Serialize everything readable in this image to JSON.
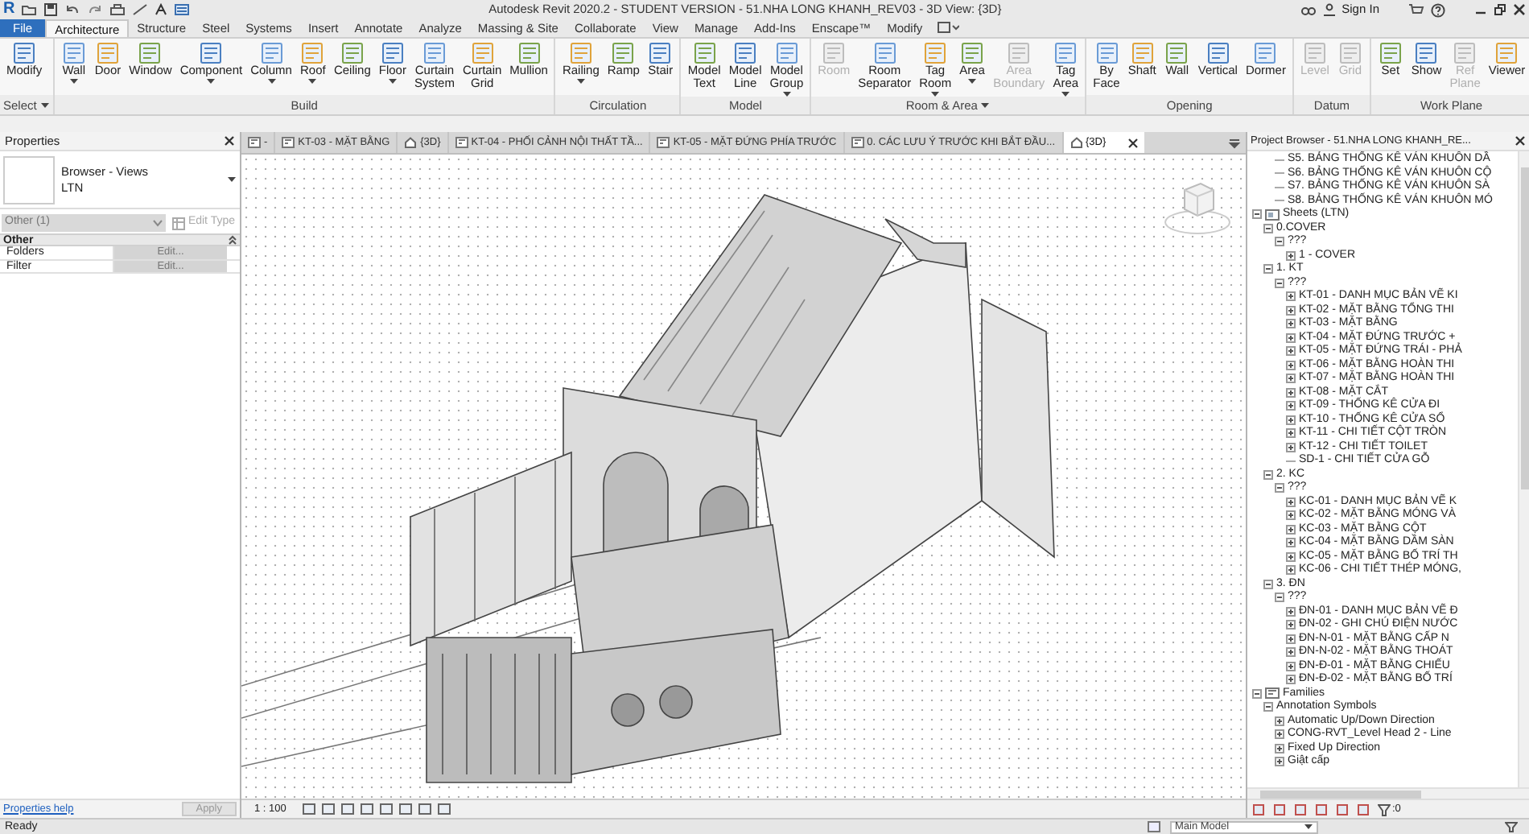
{
  "title_bar": {
    "logo": "R",
    "title": "Autodesk Revit 2020.2 - STUDENT VERSION - 51.NHA LONG KHANH_REV03 - 3D View: {3D}",
    "sign_in": "Sign In"
  },
  "ribbon_tabs": [
    {
      "label": "File",
      "kind": "file",
      "selected": false
    },
    {
      "label": "Architecture",
      "kind": "tab",
      "selected": true
    },
    {
      "label": "Structure",
      "kind": "tab",
      "selected": false
    },
    {
      "label": "Steel",
      "kind": "tab",
      "selected": false
    },
    {
      "label": "Systems",
      "kind": "tab",
      "selected": false
    },
    {
      "label": "Insert",
      "kind": "tab",
      "selected": false
    },
    {
      "label": "Annotate",
      "kind": "tab",
      "selected": false
    },
    {
      "label": "Analyze",
      "kind": "tab",
      "selected": false
    },
    {
      "label": "Massing & Site",
      "kind": "tab",
      "selected": false
    },
    {
      "label": "Collaborate",
      "kind": "tab",
      "selected": false
    },
    {
      "label": "View",
      "kind": "tab",
      "selected": false
    },
    {
      "label": "Manage",
      "kind": "tab",
      "selected": false
    },
    {
      "label": "Add-Ins",
      "kind": "tab",
      "selected": false
    },
    {
      "label": "Enscape™",
      "kind": "tab",
      "selected": false
    },
    {
      "label": "Modify",
      "kind": "tab",
      "selected": false
    }
  ],
  "ribbon_panels": [
    {
      "title": "Select",
      "menu": true,
      "tools": [
        {
          "label": "Modify",
          "disabled": false,
          "dropdown": false
        }
      ]
    },
    {
      "title": "Build",
      "menu": false,
      "tools": [
        {
          "label": "Wall",
          "disabled": false,
          "dropdown": true
        },
        {
          "label": "Door",
          "disabled": false,
          "dropdown": false
        },
        {
          "label": "Window",
          "disabled": false,
          "dropdown": false
        },
        {
          "label": "Component",
          "disabled": false,
          "dropdown": true
        },
        {
          "label": "Column",
          "disabled": false,
          "dropdown": true
        },
        {
          "label": "Roof",
          "disabled": false,
          "dropdown": true
        },
        {
          "label": "Ceiling",
          "disabled": false,
          "dropdown": false
        },
        {
          "label": "Floor",
          "disabled": false,
          "dropdown": true
        },
        {
          "label": "Curtain System",
          "disabled": false,
          "dropdown": false
        },
        {
          "label": "Curtain Grid",
          "disabled": false,
          "dropdown": false
        },
        {
          "label": "Mullion",
          "disabled": false,
          "dropdown": false
        }
      ]
    },
    {
      "title": "Circulation",
      "menu": false,
      "tools": [
        {
          "label": "Railing",
          "disabled": false,
          "dropdown": true
        },
        {
          "label": "Ramp",
          "disabled": false,
          "dropdown": false
        },
        {
          "label": "Stair",
          "disabled": false,
          "dropdown": false
        }
      ]
    },
    {
      "title": "Model",
      "menu": false,
      "tools": [
        {
          "label": "Model Text",
          "disabled": false,
          "dropdown": false
        },
        {
          "label": "Model Line",
          "disabled": false,
          "dropdown": false
        },
        {
          "label": "Model Group",
          "disabled": false,
          "dropdown": true
        }
      ]
    },
    {
      "title": "Room & Area",
      "menu": true,
      "tools": [
        {
          "label": "Room",
          "disabled": true,
          "dropdown": false
        },
        {
          "label": "Room Separator",
          "disabled": false,
          "dropdown": false
        },
        {
          "label": "Tag Room",
          "disabled": false,
          "dropdown": true
        },
        {
          "label": "Area",
          "disabled": false,
          "dropdown": true
        },
        {
          "label": "Area Boundary",
          "disabled": true,
          "dropdown": false
        },
        {
          "label": "Tag Area",
          "disabled": false,
          "dropdown": true
        }
      ]
    },
    {
      "title": "Opening",
      "menu": false,
      "tools": [
        {
          "label": "By Face",
          "disabled": false,
          "dropdown": false
        },
        {
          "label": "Shaft",
          "disabled": false,
          "dropdown": false
        },
        {
          "label": "Wall",
          "disabled": false,
          "dropdown": false
        },
        {
          "label": "Vertical",
          "disabled": false,
          "dropdown": false
        },
        {
          "label": "Dormer",
          "disabled": false,
          "dropdown": false
        }
      ]
    },
    {
      "title": "Datum",
      "menu": false,
      "tools": [
        {
          "label": "Level",
          "disabled": true,
          "dropdown": false
        },
        {
          "label": "Grid",
          "disabled": true,
          "dropdown": false
        }
      ]
    },
    {
      "title": "Work Plane",
      "menu": false,
      "tools": [
        {
          "label": "Set",
          "disabled": false,
          "dropdown": false
        },
        {
          "label": "Show",
          "disabled": false,
          "dropdown": false
        },
        {
          "label": "Ref Plane",
          "disabled": true,
          "dropdown": false
        },
        {
          "label": "Viewer",
          "disabled": false,
          "dropdown": false
        }
      ]
    }
  ],
  "properties": {
    "title": "Properties",
    "type_name": "Browser - Views",
    "type_value": "LTN",
    "selector": "Other (1)",
    "edit_type": {
      "label": "Edit Type",
      "disabled": true
    },
    "section": "Other",
    "rows": [
      {
        "name": "Folders",
        "value": "Edit..."
      },
      {
        "name": "Filter",
        "value": "Edit..."
      }
    ],
    "help_link": "Properties help",
    "apply": "Apply"
  },
  "view_tabs": [
    {
      "label": "-",
      "kind": "plan",
      "selected": false
    },
    {
      "label": "KT-03 - MẶT BẰNG",
      "kind": "plan",
      "selected": false
    },
    {
      "label": "{3D}",
      "kind": "model3d",
      "selected": false
    },
    {
      "label": "KT-04 - PHỐI CẢNH NỘI THẤT TẦ...",
      "kind": "plan",
      "selected": false
    },
    {
      "label": "KT-05 - MẶT ĐỨNG PHÍA TRƯỚC",
      "kind": "plan",
      "selected": false
    },
    {
      "label": "0. CÁC LƯU Ý TRƯỚC KHI BẮT ĐẦU...",
      "kind": "plan",
      "selected": false
    },
    {
      "label": "{3D}",
      "kind": "model3d",
      "selected": true
    }
  ],
  "view_control_bar": {
    "scale": "1 : 100"
  },
  "project_browser": {
    "title": "Project Browser - 51.NHA LONG KHANH_RE...",
    "continued_items": [
      {
        "label": "S5. BẢNG THỐNG KÊ VÁN KHUÔN DẦ"
      },
      {
        "label": "S6. BẢNG THỐNG KÊ VÁN KHUÔN CỘ"
      },
      {
        "label": "S7. BẢNG THỐNG KÊ VÁN KHUÔN SÀ"
      },
      {
        "label": "S8. BẢNG THỐNG KÊ VÁN KHUÔN MÓ"
      }
    ],
    "tree": [
      {
        "label": "Sheets (LTN)",
        "kind": "sheets",
        "expanded": true,
        "children": [
          {
            "label": "0.COVER",
            "expanded": true,
            "children": [
              {
                "label": "???",
                "expanded": true,
                "children": [
                  {
                    "label": "1 - COVER",
                    "expanded": false
                  }
                ]
              }
            ]
          },
          {
            "label": "1. KT",
            "expanded": true,
            "children": [
              {
                "label": "???",
                "expanded": true,
                "children": [
                  {
                    "label": "KT-01 - DANH MỤC BẢN VẼ KI",
                    "expanded": false
                  },
                  {
                    "label": "KT-02 - MẶT BẰNG TỔNG THI",
                    "expanded": false
                  },
                  {
                    "label": "KT-03 - MẶT BẰNG",
                    "expanded": false
                  },
                  {
                    "label": "KT-04 - MẶT ĐỨNG TRƯỚC +",
                    "expanded": false
                  },
                  {
                    "label": "KT-05 - MẶT ĐỨNG TRÁI - PHẢ",
                    "expanded": false
                  },
                  {
                    "label": "KT-06 - MẶT BẰNG HOÀN THI",
                    "expanded": false
                  },
                  {
                    "label": "KT-07 - MẶT BẰNG HOÀN THI",
                    "expanded": false
                  },
                  {
                    "label": "KT-08 - MẶT CẮT",
                    "expanded": false
                  },
                  {
                    "label": "KT-09 - THỐNG KÊ CỬA ĐI",
                    "expanded": false
                  },
                  {
                    "label": "KT-10 - THỐNG KÊ CỬA SỔ",
                    "expanded": false
                  },
                  {
                    "label": "KT-11 - CHI TIẾT CỘT TRÒN",
                    "expanded": false
                  },
                  {
                    "label": "KT-12 - CHI TIẾT TOILET",
                    "expanded": false
                  },
                  {
                    "label": "SD-1 - CHI TIẾT CỬA GỖ"
                  }
                ]
              }
            ]
          },
          {
            "label": "2. KC",
            "expanded": true,
            "children": [
              {
                "label": "???",
                "expanded": true,
                "children": [
                  {
                    "label": "KC-01 - DANH MỤC BẢN VẼ K",
                    "expanded": false
                  },
                  {
                    "label": "KC-02 - MẶT BẰNG MÓNG VÀ",
                    "expanded": false
                  },
                  {
                    "label": "KC-03 - MẶT BẰNG CỘT",
                    "expanded": false
                  },
                  {
                    "label": "KC-04 - MẶT BẰNG DẦM SÀN",
                    "expanded": false
                  },
                  {
                    "label": "KC-05 - MẶT BẰNG BỐ TRÍ TH",
                    "expanded": false
                  },
                  {
                    "label": "KC-06 - CHI TIẾT THÉP MÓNG,",
                    "expanded": false
                  }
                ]
              }
            ]
          },
          {
            "label": "3. ĐN",
            "expanded": true,
            "children": [
              {
                "label": "???",
                "expanded": true,
                "children": [
                  {
                    "label": "ĐN-01 - DANH MỤC BẢN VẼ Đ",
                    "expanded": false
                  },
                  {
                    "label": "ĐN-02 - GHI CHÚ ĐIỆN NƯỚC",
                    "expanded": false
                  },
                  {
                    "label": "ĐN-N-01 - MẶT BẰNG CẤP N",
                    "expanded": false
                  },
                  {
                    "label": "ĐN-N-02 - MẶT BẰNG THOÁT",
                    "expanded": false
                  },
                  {
                    "label": "ĐN-Đ-01 - MẶT BẰNG CHIẾU",
                    "expanded": false
                  },
                  {
                    "label": "ĐN-Đ-02 - MẶT BẰNG BỐ TRÍ",
                    "expanded": false
                  }
                ]
              }
            ]
          }
        ]
      },
      {
        "label": "Families",
        "kind": "families",
        "expanded": true,
        "children": [
          {
            "label": "Annotation Symbols",
            "expanded": true,
            "children": [
              {
                "label": "Automatic Up/Down Direction",
                "expanded": false
              },
              {
                "label": "CONG-RVT_Level Head 2 - Line",
                "expanded": false
              },
              {
                "label": "Fixed Up Direction",
                "expanded": false
              },
              {
                "label": "Giật cấp",
                "expanded": false
              }
            ]
          }
        ]
      }
    ],
    "filter_count": ":0"
  },
  "status_bar": {
    "text": "Ready",
    "model": "Main Model"
  }
}
